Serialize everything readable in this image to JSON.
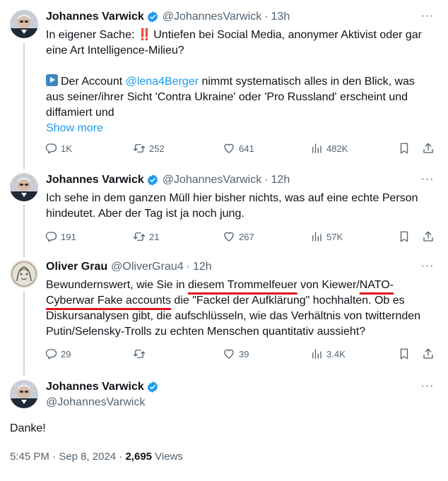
{
  "tweets": [
    {
      "name": "Johannes Varwick",
      "handle": "@JohannesVarwick",
      "time": "13h",
      "lines": {
        "l1_prefix": "In eigener Sache: ",
        "l1_emoji": "‼️",
        "l1_rest": " Untiefen bei Social Media, anonymer Aktivist oder gar",
        "l2": "eine Art Intelligence-Milieu?",
        "l3_prefix": "Der Account  ",
        "l3_mention": "@lena4Berger",
        "l3_rest": " nimmt systematisch alles in den Blick, was",
        "l4": "aus seiner/ihrer Sicht 'Contra Ukraine' oder 'Pro Russland' erscheint und",
        "l5": "diffamiert und",
        "show_more": "Show more"
      },
      "actions": {
        "replies": "1K",
        "reposts": "252",
        "likes": "641",
        "views": "482K"
      }
    },
    {
      "name": "Johannes Varwick",
      "handle": "@JohannesVarwick",
      "time": "12h",
      "lines": {
        "l1": "Ich sehe in dem ganzen Müll hier bisher nichts, was auf eine echte Person",
        "l2": "hindeutet. Aber der Tag ist ja noch jung."
      },
      "actions": {
        "replies": "191",
        "reposts": "21",
        "likes": "267",
        "views": "57K"
      }
    },
    {
      "name": "Oliver Grau",
      "handle": "@OliverGrau4",
      "time": "12h",
      "lines": {
        "l1_a": "Bewundernswert, wie Sie in ",
        "l1_u": "diesem Trommelfeuer",
        "l1_b": " von Kiewer/",
        "l1_u2": "NATO-",
        "l2_u": "Cyberwar Fake accounts",
        "l2_b": " die \"Fackel der Aufklärung\" hochhalten. Ob es",
        "l3": "Diskursanalysen gibt, die aufschlüsseln, wie das Verhältnis von twitternden",
        "l4": "Putin/Selensky-Trolls zu echten Menschen quantitativ aussieht?"
      },
      "actions": {
        "replies": "29",
        "reposts": "",
        "likes": "39",
        "views": "3.4K"
      }
    }
  ],
  "main": {
    "name": "Johannes Varwick",
    "handle": "@JohannesVarwick",
    "text": "Danke!",
    "time": "5:45 PM",
    "date": "Sep 8, 2024",
    "views_count": "2,695",
    "views_label": " Views"
  },
  "more_glyph": "···",
  "separator_dot": "·",
  "colors": {
    "accent": "#1d9bf0",
    "underline_mark": "#e0161d",
    "muted": "#536471"
  }
}
